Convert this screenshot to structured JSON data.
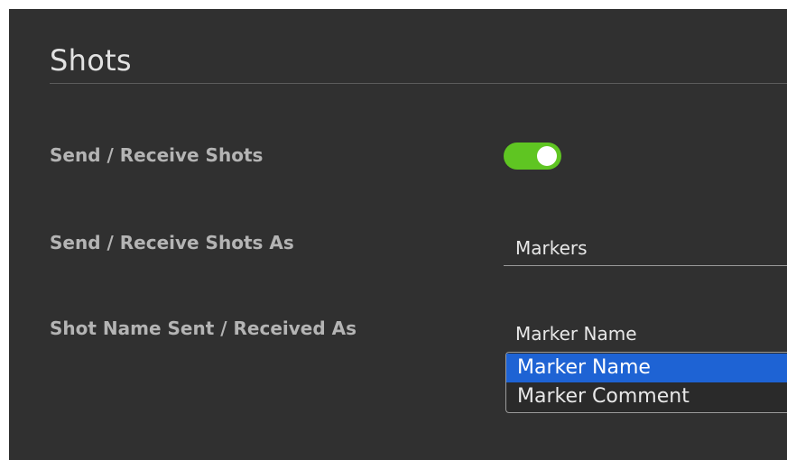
{
  "section": {
    "title": "Shots"
  },
  "settings": {
    "send_receive_shots": {
      "label": "Send / Receive Shots",
      "enabled": true
    },
    "send_receive_shots_as": {
      "label": "Send / Receive Shots As",
      "value": "Markers"
    },
    "shot_name_as": {
      "label": "Shot Name Sent / Received As",
      "value": "Marker Name",
      "options": [
        {
          "label": "Marker Name",
          "selected": true
        },
        {
          "label": "Marker Comment",
          "selected": false
        }
      ]
    }
  },
  "colors": {
    "panel_background": "#303030",
    "toggle_on": "#5fc522",
    "selection_highlight": "#1e63d4"
  }
}
